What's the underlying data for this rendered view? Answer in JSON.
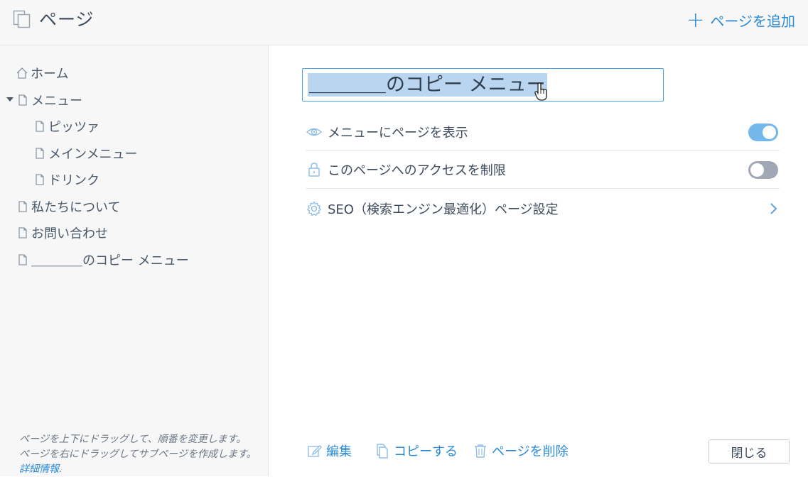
{
  "header": {
    "title": "ページ",
    "add_page_label": "ページを追加"
  },
  "sidebar": {
    "items": [
      {
        "label": "ホーム",
        "icon": "home-icon"
      },
      {
        "label": "メニュー",
        "icon": "page-icon"
      },
      {
        "label": "ピッツァ",
        "icon": "page-icon"
      },
      {
        "label": "メインメニュー",
        "icon": "page-icon"
      },
      {
        "label": "ドリンク",
        "icon": "page-icon"
      },
      {
        "label": "私たちについて",
        "icon": "page-icon"
      },
      {
        "label": "お問い合わせ",
        "icon": "page-icon"
      },
      {
        "label": "＿＿＿＿のコピー メニュー",
        "icon": "page-icon"
      }
    ],
    "help_line1": "ページを上下にドラッグして、順番を変更します。",
    "help_line2": "ページを右にドラッグしてサブページを作成します。",
    "help_link": "詳細情報"
  },
  "editor": {
    "page_name_value": "＿＿＿＿のコピー メニュー",
    "settings": [
      {
        "label": "メニューにページを表示",
        "icon": "eye-icon",
        "toggle": true
      },
      {
        "label": "このページへのアクセスを制限",
        "icon": "lock-icon",
        "toggle": false
      },
      {
        "label": "SEO（検索エンジン最適化）ページ設定",
        "icon": "gear-icon"
      }
    ]
  },
  "footer": {
    "edit_label": "編集",
    "copy_label": "コピーする",
    "delete_label": "ページを削除",
    "close_label": "閉じる"
  },
  "colors": {
    "accent": "#2b8ad7",
    "selection": "#bad5ef",
    "toggle_on": "#74b7ea",
    "toggle_off": "#a0a8b5"
  }
}
